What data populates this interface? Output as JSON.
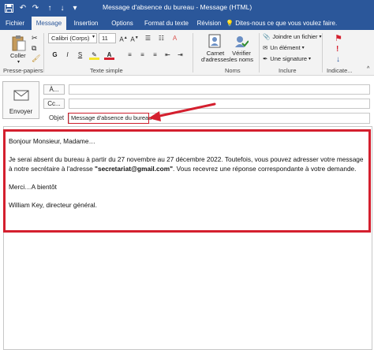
{
  "window": {
    "title": "Message d'absence du bureau - Message (HTML)"
  },
  "tabs": [
    {
      "label": "Fichier"
    },
    {
      "label": "Message"
    },
    {
      "label": "Insertion"
    },
    {
      "label": "Options"
    },
    {
      "label": "Format du texte"
    },
    {
      "label": "Révision"
    }
  ],
  "tell_me": "Dites-nous ce que vous voulez faire.",
  "ribbon": {
    "clipboard": {
      "paste_label": "Coller",
      "group_label": "Presse-papiers"
    },
    "basic_text": {
      "font_name": "Calibri (Corps)",
      "font_size": "11",
      "group_label": "Texte simple",
      "bold": "G",
      "italic": "I",
      "underline": "S"
    },
    "names": {
      "address_book_label": "Carnet d'adresses",
      "check_names_label": "Vérifier les noms",
      "group_label": "Noms"
    },
    "include": {
      "attach_file": "Joindre un fichier",
      "item": "Un élément",
      "signature": "Une signature",
      "group_label": "Inclure"
    },
    "tags": {
      "group_label": "Indicate..."
    }
  },
  "header": {
    "send_label": "Envoyer",
    "to_label": "À...",
    "cc_label": "Cc...",
    "subject_label": "Objet",
    "subject_value": "Message d'absence du bureau"
  },
  "body": {
    "greeting": "Bonjour Monsieur, Madame…",
    "para_start": "Je serai absent du bureau à partir du 27 novembre au 27 décembre 2022. Toutefois, vous pouvez adresser votre message à notre secrétaire à l'adresse ",
    "email": "\"secretariat@gmail.com\"",
    "para_end": ". Vous recevrez une réponse correspondante à votre demande.",
    "thanks": "Merci…A bientôt",
    "signature": "William Key, directeur général."
  },
  "colors": {
    "accent": "#2b579a",
    "highlight": "#d41f2e"
  }
}
